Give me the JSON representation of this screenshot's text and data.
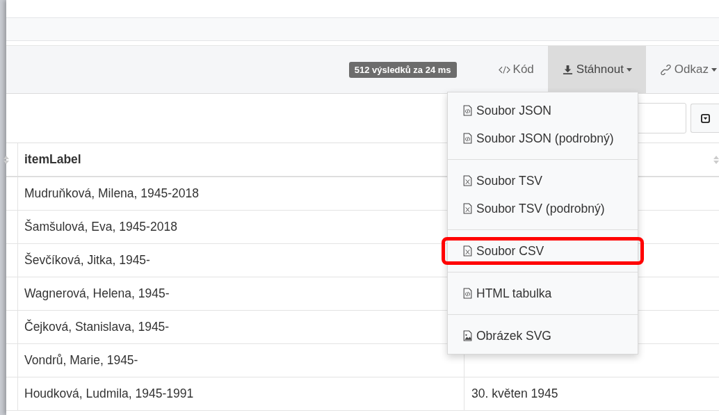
{
  "toolbar": {
    "result_badge": "512 výsledků za 24 ms",
    "buttons": [
      {
        "label": "Kód",
        "kind": "code",
        "caret": false,
        "selected": false
      },
      {
        "label": "Stáhnout",
        "kind": "download",
        "caret": true,
        "selected": true
      },
      {
        "label": "Odkaz",
        "kind": "link",
        "caret": true,
        "selected": false
      }
    ]
  },
  "download_menu": {
    "groups": [
      [
        {
          "label": "Soubor JSON",
          "kind": "code",
          "highlighted": false
        },
        {
          "label": "Soubor JSON (podrobný)",
          "kind": "code",
          "highlighted": false
        }
      ],
      [
        {
          "label": "Soubor TSV",
          "kind": "sheet",
          "highlighted": false
        },
        {
          "label": "Soubor TSV (podrobný)",
          "kind": "sheet",
          "highlighted": false
        }
      ],
      [
        {
          "label": "Soubor CSV",
          "kind": "sheet",
          "highlighted": true
        }
      ],
      [
        {
          "label": "HTML tabulka",
          "kind": "code",
          "highlighted": false
        }
      ],
      [
        {
          "label": "Obrázek SVG",
          "kind": "image",
          "highlighted": false
        }
      ]
    ]
  },
  "table": {
    "columns": [
      "itemLabel"
    ],
    "rows": [
      {
        "item_label": "Mudruňková, Milena, 1945-2018",
        "column_2": ""
      },
      {
        "item_label": "Šamšulová, Eva, 1945-2018",
        "column_2": ""
      },
      {
        "item_label": "Ševčíková, Jitka, 1945-",
        "column_2": ""
      },
      {
        "item_label": "Wagnerová, Helena, 1945-",
        "column_2": ""
      },
      {
        "item_label": "Čejková, Stanislava, 1945-",
        "column_2": ""
      },
      {
        "item_label": "Vondrů, Marie, 1945-",
        "column_2": ""
      },
      {
        "item_label": "Houdková, Ludmila, 1945-1991",
        "column_2": "30. květen 1945"
      }
    ]
  }
}
